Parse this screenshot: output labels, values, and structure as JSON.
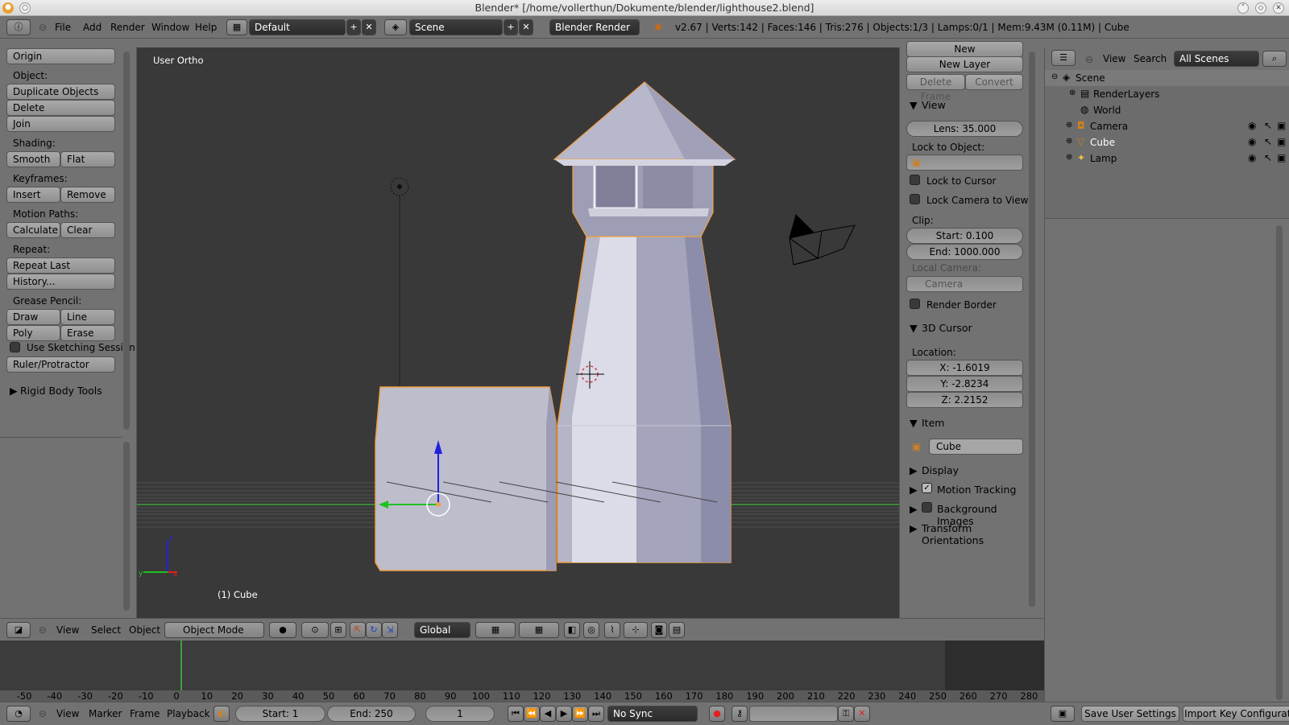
{
  "window": {
    "title": "Blender* [/home/vollerthun/Dokumente/blender/lighthouse2.blend]"
  },
  "info": {
    "menus": [
      "File",
      "Add",
      "Render",
      "Window",
      "Help"
    ],
    "layout": "Default",
    "scene": "Scene",
    "engine": "Blender Render",
    "stats": "v2.67 | Verts:142 | Faces:146 | Tris:276 | Objects:1/3 | Lamps:0/1 | Mem:9.43M (0.11M) | Cube"
  },
  "tools": {
    "origin": "Origin",
    "object_label": "Object:",
    "duplicate": "Duplicate Objects",
    "delete": "Delete",
    "join": "Join",
    "shading_label": "Shading:",
    "smooth": "Smooth",
    "flat": "Flat",
    "keyframes_label": "Keyframes:",
    "insert": "Insert",
    "remove": "Remove",
    "motion_label": "Motion Paths:",
    "calculate": "Calculate",
    "clear": "Clear",
    "repeat_label": "Repeat:",
    "repeat_last": "Repeat Last",
    "history": "History...",
    "grease_label": "Grease Pencil:",
    "draw": "Draw",
    "line": "Line",
    "poly": "Poly",
    "erase": "Erase",
    "sketching": "Use Sketching Session",
    "ruler": "Ruler/Protractor",
    "rigid": "Rigid Body Tools"
  },
  "viewport": {
    "view_name": "User Ortho",
    "object_name": "(1) Cube"
  },
  "properties": {
    "new": "New",
    "new_layer": "New Layer",
    "delete_frame": "Delete Frame",
    "convert": "Convert",
    "view_header": "View",
    "lens": "Lens: 35.000",
    "lock_to_object": "Lock to Object:",
    "lock_cursor": "Lock to Cursor",
    "lock_camera": "Lock Camera to View",
    "clip": "Clip:",
    "clip_start": "Start: 0.100",
    "clip_end": "End: 1000.000",
    "local_camera": "Local Camera:",
    "camera": "Camera",
    "render_border": "Render Border",
    "cursor_header": "3D Cursor",
    "location": "Location:",
    "x": "X: -1.6019",
    "y": "Y: -2.8234",
    "z": "Z: 2.2152",
    "item_header": "Item",
    "item_name": "Cube",
    "display": "Display",
    "motion_tracking": "Motion Tracking",
    "background_images": "Background Images",
    "transform_orientations": "Transform Orientations"
  },
  "outliner": {
    "view": "View",
    "search": "Search",
    "scenes": "All Scenes",
    "items": [
      "Scene",
      "RenderLayers",
      "World",
      "Camera",
      "Cube",
      "Lamp"
    ]
  },
  "view3d_header": {
    "view": "View",
    "select": "Select",
    "object": "Object",
    "mode": "Object Mode",
    "orientation": "Global"
  },
  "timeline": {
    "ticks": [
      "-50",
      "-40",
      "-30",
      "-20",
      "-10",
      "0",
      "10",
      "20",
      "30",
      "40",
      "50",
      "60",
      "70",
      "80",
      "90",
      "100",
      "110",
      "120",
      "130",
      "140",
      "150",
      "160",
      "170",
      "180",
      "190",
      "200",
      "210",
      "220",
      "230",
      "240",
      "250",
      "260",
      "270",
      "280"
    ],
    "view": "View",
    "marker": "Marker",
    "frame": "Frame",
    "playback": "Playback",
    "start": "Start: 1",
    "end": "End: 250",
    "current": "1",
    "sync": "No Sync"
  },
  "user_prefs": {
    "save": "Save User Settings",
    "import_key": "Import Key Configurati"
  },
  "colors": {
    "accent_selected": "#f0a040",
    "grid_green": "#3ca03c"
  }
}
